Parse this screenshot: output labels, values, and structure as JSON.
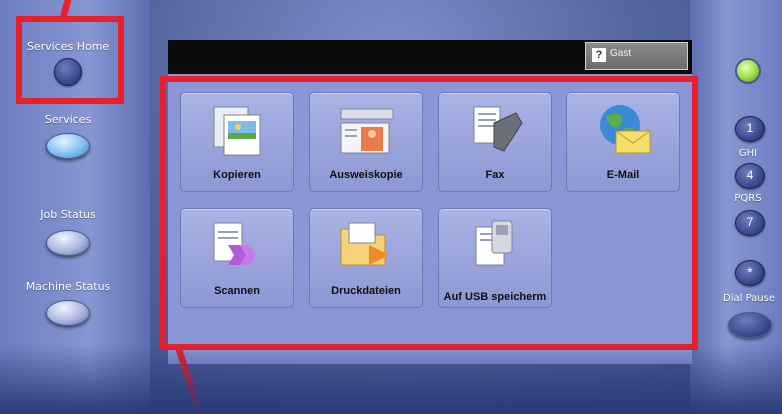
{
  "left_controls": {
    "services_home": "Services Home",
    "services": "Services",
    "job_status": "Job Status",
    "machine_status": "Machine Status"
  },
  "right_controls": {
    "key_1": "1",
    "ghi": "GHI",
    "key_4": "4",
    "pqrs": "PQRS",
    "key_7": "7",
    "key_star": "*",
    "dial_pause": "Dial Pause"
  },
  "screen": {
    "login_label": "Gast"
  },
  "tiles": [
    {
      "label": "Kopieren",
      "icon": "copy-icon"
    },
    {
      "label": "Ausweiskopie",
      "icon": "id-card-icon"
    },
    {
      "label": "Fax",
      "icon": "fax-icon"
    },
    {
      "label": "E-Mail",
      "icon": "email-icon"
    },
    {
      "label": "Scannen",
      "icon": "scan-icon"
    },
    {
      "label": "Druckdateien",
      "icon": "print-files-icon"
    },
    {
      "label": "Auf USB speicherm",
      "icon": "usb-icon"
    }
  ],
  "colors": {
    "highlight": "#e8202b",
    "screen_bg": "#8c95d6",
    "panel": "#55669f"
  }
}
